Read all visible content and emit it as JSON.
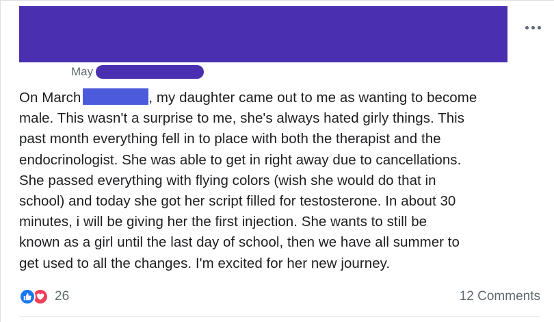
{
  "post": {
    "date_label": "May",
    "text_lines": {
      "l1_before": "On March",
      "l1_after": ", my daughter came out to me as wanting to become",
      "l2": "male. This wasn't a surprise to me, she's always hated girly things. This",
      "l3": "past month everything fell in to place with both the therapist and the",
      "l4": "endocrinologist. She was able to get in right away due to cancellations.",
      "l5": "She passed everything with flying colors (wish she would do that in",
      "l6": "school) and today she got her script filled for testosterone. In about 30",
      "l7": "minutes, i will be giving her the first injection. She wants to still be",
      "l8": "known as a girl until the last day of school, then we have all summer to",
      "l9": "get used to all the changes. I'm excited for her new journey."
    }
  },
  "footer": {
    "reaction_count": "26",
    "comments_label": "12 Comments",
    "reaction_icons": [
      "like-icon",
      "love-icon"
    ]
  },
  "icons": {
    "more": "more-options-icon"
  },
  "colors": {
    "redaction_header": "#4a2fb0",
    "redaction_inline": "#4b5bdc",
    "like_blue": "#1877f2",
    "love_red": "#f33e58",
    "text": "#1c1e21",
    "secondary_text": "#606770"
  }
}
